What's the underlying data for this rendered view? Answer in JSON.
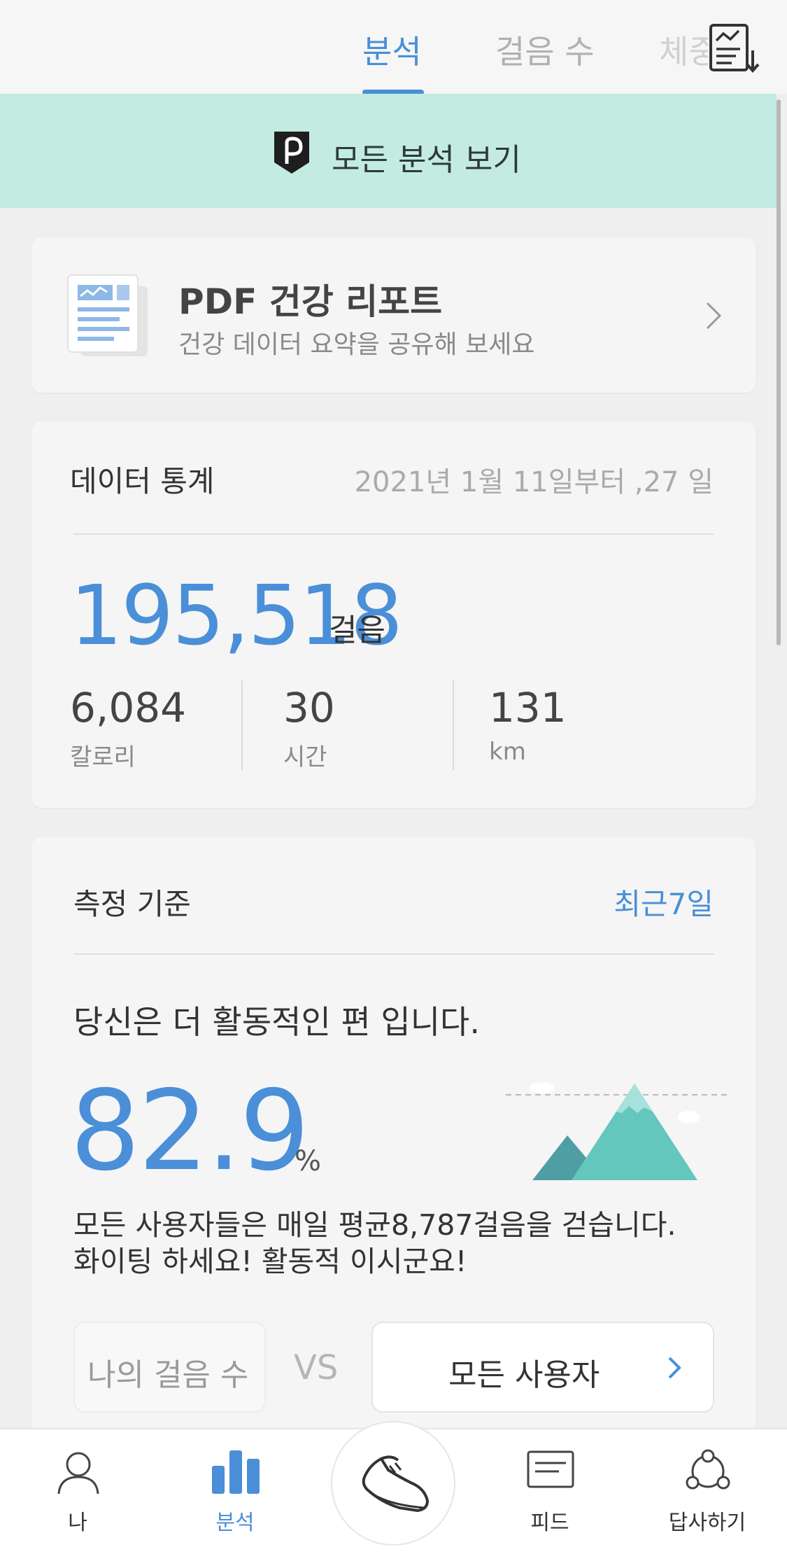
{
  "tabs": [
    {
      "label": "분석",
      "active": true
    },
    {
      "label": "걸음 수",
      "active": false
    },
    {
      "label": "체중",
      "active": false
    }
  ],
  "banner": {
    "text": "모든 분석 보기"
  },
  "pdf_report": {
    "title": "PDF 건강 리포트",
    "subtitle": "건강 데이터 요약을 공유해 보세요"
  },
  "stats": {
    "title": "데이터 통계",
    "date_range": "2021년 1월 11일부터 ,27 일",
    "steps": "195,518",
    "steps_unit": "걸음",
    "metrics": [
      {
        "value": "6,084",
        "label": "칼로리"
      },
      {
        "value": "30",
        "label": "시간"
      },
      {
        "value": "131",
        "label": "km"
      }
    ]
  },
  "comparison": {
    "title": "측정 기준",
    "range": "최근7일",
    "headline": "당신은 더 활동적인 편 입니다.",
    "percent": "82.9",
    "percent_unit": "%",
    "line1": "모든 사용자들은 매일 평균8,787걸음을 걷습니다.",
    "line2": "화이팅 하세요! 활동적 이시군요!",
    "my_steps_label": "나의 걸음 수",
    "vs": "VS",
    "all_users_label": "모든 사용자"
  },
  "bottom_nav": [
    {
      "label": "나",
      "icon": "person-icon"
    },
    {
      "label": "분석",
      "icon": "bar-chart-icon",
      "active": true
    },
    {
      "label": "",
      "icon": "shoe-icon"
    },
    {
      "label": "피드",
      "icon": "feed-icon"
    },
    {
      "label": "답사하기",
      "icon": "community-icon"
    }
  ],
  "colors": {
    "accent": "#4a8fd8",
    "banner_bg": "#c3ebe2",
    "page_bg": "#efefef",
    "mountain_dark": "#4f9ea3",
    "mountain_light": "#64c7be"
  }
}
